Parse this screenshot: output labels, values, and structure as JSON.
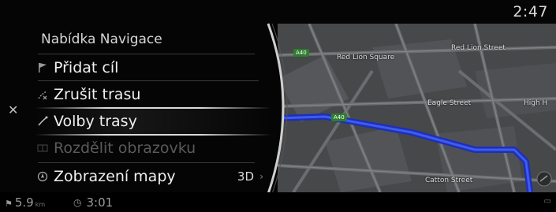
{
  "status": {
    "clock": "2:47"
  },
  "menu": {
    "title": "Nabídka Navigace",
    "items": [
      {
        "label": "Přidat cíl",
        "icon": "flag-icon",
        "enabled": true
      },
      {
        "label": "Zrušit trasu",
        "icon": "cancel-route-icon",
        "enabled": true
      },
      {
        "label": "Volby trasy",
        "icon": "route-options-icon",
        "enabled": true,
        "selected": true
      },
      {
        "label": "Rozdělit obrazovku",
        "icon": "split-screen-icon",
        "enabled": false
      },
      {
        "label": "Zobrazení mapy",
        "icon": "map-view-icon",
        "enabled": true,
        "value": "3D"
      }
    ]
  },
  "map": {
    "streets": [
      "Red Lion Square",
      "Red Lion Street",
      "Eagle Street",
      "High H",
      "Catton Street"
    ],
    "road_shields": [
      "A40",
      "A40"
    ],
    "route_color": "#2a43d6"
  },
  "bottom_bar": {
    "distance": "5.9",
    "distance_unit": "km",
    "arrival_time": "3:01"
  },
  "colors": {
    "background": "#050505",
    "route": "#2a43d6",
    "text": "#f0f0f0",
    "disabled_text": "#5a5a5a"
  }
}
